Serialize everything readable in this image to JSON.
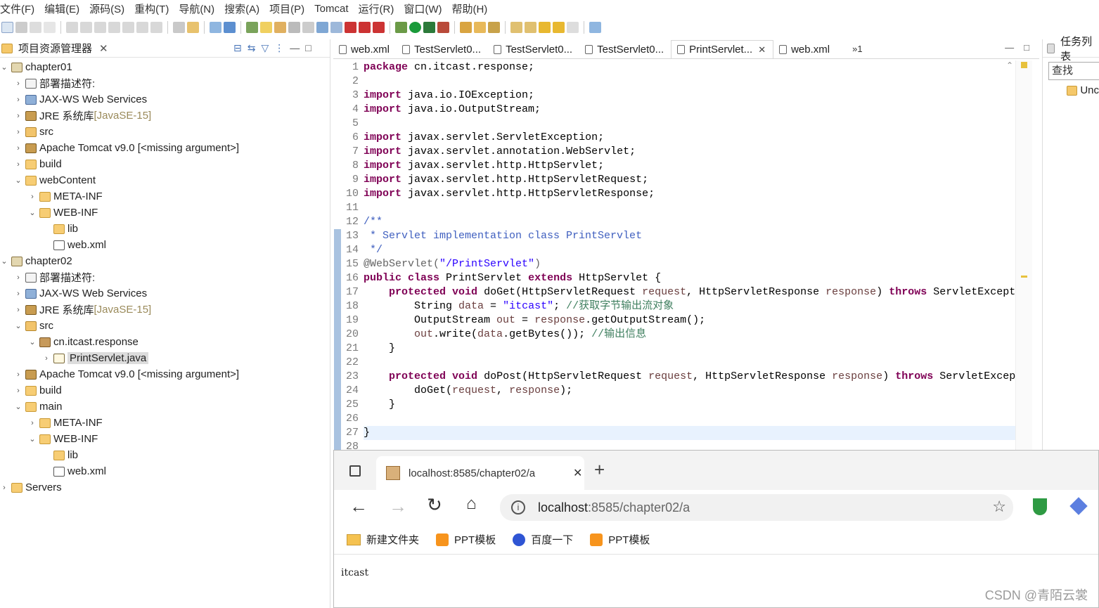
{
  "menu": [
    "文件(F)",
    "编辑(E)",
    "源码(S)",
    "重构(T)",
    "导航(N)",
    "搜索(A)",
    "项目(P)",
    "Tomcat",
    "运行(R)",
    "窗口(W)",
    "帮助(H)"
  ],
  "explorer": {
    "title": "项目资源管理器",
    "tree": [
      {
        "label": "chapter01",
        "suffix": "",
        "indent": 0,
        "arrow": "⌄",
        "icon": "project-icon"
      },
      {
        "label": "部署描述符:",
        "suffix": "",
        "indent": 1,
        "arrow": "›",
        "icon": "descriptor-icon"
      },
      {
        "label": "JAX-WS Web Services",
        "suffix": "",
        "indent": 1,
        "arrow": "›",
        "icon": "webservice-icon"
      },
      {
        "label": "JRE 系统库 ",
        "suffix": "[JavaSE-15]",
        "indent": 1,
        "arrow": "›",
        "icon": "library-icon"
      },
      {
        "label": "src",
        "suffix": "",
        "indent": 1,
        "arrow": "›",
        "icon": "source-folder-icon"
      },
      {
        "label": "Apache Tomcat v9.0 [<missing argument>]",
        "suffix": "",
        "indent": 1,
        "arrow": "›",
        "icon": "library-icon"
      },
      {
        "label": "build",
        "suffix": "",
        "indent": 1,
        "arrow": "›",
        "icon": "folder-icon"
      },
      {
        "label": "webContent",
        "suffix": "",
        "indent": 1,
        "arrow": "⌄",
        "icon": "folder-icon"
      },
      {
        "label": "META-INF",
        "suffix": "",
        "indent": 2,
        "arrow": "›",
        "icon": "folder-icon"
      },
      {
        "label": "WEB-INF",
        "suffix": "",
        "indent": 2,
        "arrow": "⌄",
        "icon": "folder-icon"
      },
      {
        "label": "lib",
        "suffix": "",
        "indent": 3,
        "arrow": "",
        "icon": "folder-icon"
      },
      {
        "label": "web.xml",
        "suffix": "",
        "indent": 3,
        "arrow": "",
        "icon": "xml-file-icon"
      },
      {
        "label": "chapter02",
        "suffix": "",
        "indent": 0,
        "arrow": "⌄",
        "icon": "project-icon"
      },
      {
        "label": "部署描述符:",
        "suffix": "",
        "indent": 1,
        "arrow": "›",
        "icon": "descriptor-icon"
      },
      {
        "label": "JAX-WS Web Services",
        "suffix": "",
        "indent": 1,
        "arrow": "›",
        "icon": "webservice-icon"
      },
      {
        "label": "JRE 系统库 ",
        "suffix": "[JavaSE-15]",
        "indent": 1,
        "arrow": "›",
        "icon": "library-icon"
      },
      {
        "label": "src",
        "suffix": "",
        "indent": 1,
        "arrow": "⌄",
        "icon": "source-folder-icon"
      },
      {
        "label": "cn.itcast.response",
        "suffix": "",
        "indent": 2,
        "arrow": "⌄",
        "icon": "package-icon"
      },
      {
        "label": "PrintServlet.java",
        "suffix": "",
        "indent": 3,
        "arrow": "›",
        "icon": "java-file-icon",
        "selected": true
      },
      {
        "label": "Apache Tomcat v9.0 [<missing argument>]",
        "suffix": "",
        "indent": 1,
        "arrow": "›",
        "icon": "library-icon"
      },
      {
        "label": "build",
        "suffix": "",
        "indent": 1,
        "arrow": "›",
        "icon": "folder-icon"
      },
      {
        "label": "main",
        "suffix": "",
        "indent": 1,
        "arrow": "⌄",
        "icon": "folder-icon"
      },
      {
        "label": "META-INF",
        "suffix": "",
        "indent": 2,
        "arrow": "›",
        "icon": "folder-icon"
      },
      {
        "label": "WEB-INF",
        "suffix": "",
        "indent": 2,
        "arrow": "⌄",
        "icon": "folder-icon"
      },
      {
        "label": "lib",
        "suffix": "",
        "indent": 3,
        "arrow": "",
        "icon": "folder-icon"
      },
      {
        "label": "web.xml",
        "suffix": "",
        "indent": 3,
        "arrow": "",
        "icon": "xml-file-icon"
      },
      {
        "label": "Servers",
        "suffix": "",
        "indent": 0,
        "arrow": "›",
        "icon": "folder-icon"
      }
    ]
  },
  "editor": {
    "tabs": [
      {
        "label": "web.xml",
        "active": false,
        "closable": false
      },
      {
        "label": "TestServlet0...",
        "active": false,
        "closable": false
      },
      {
        "label": "TestServlet0...",
        "active": false,
        "closable": false
      },
      {
        "label": "TestServlet0...",
        "active": false,
        "closable": false
      },
      {
        "label": "PrintServlet...",
        "active": true,
        "closable": true
      },
      {
        "label": "web.xml",
        "active": false,
        "closable": false
      }
    ],
    "overflow": "»1",
    "line_numbers": [
      "1",
      "2",
      "3",
      "4",
      "5",
      "6",
      "7",
      "8",
      "9",
      "10",
      "11",
      "12",
      "13",
      "14",
      "15",
      "16",
      "17",
      "18",
      "19",
      "20",
      "21",
      "22",
      "23",
      "24",
      "25",
      "26",
      "27",
      "28"
    ],
    "code": [
      [
        [
          "kw",
          "package"
        ],
        [
          "",
          "cn.itcast.response;"
        ]
      ],
      [],
      [
        [
          "kw",
          "import"
        ],
        [
          "",
          "java.io.IOException;"
        ]
      ],
      [
        [
          "kw",
          "import"
        ],
        [
          "",
          "java.io.OutputStream;"
        ]
      ],
      [],
      [
        [
          "kw",
          "import"
        ],
        [
          "",
          "javax.servlet.ServletException;"
        ]
      ],
      [
        [
          "kw",
          "import"
        ],
        [
          "",
          "javax.servlet.annotation.WebServlet;"
        ]
      ],
      [
        [
          "kw",
          "import"
        ],
        [
          "",
          "javax.servlet.http.HttpServlet;"
        ]
      ],
      [
        [
          "kw",
          "import"
        ],
        [
          "",
          "javax.servlet.http.HttpServletRequest;"
        ]
      ],
      [
        [
          "kw",
          "import"
        ],
        [
          "",
          "javax.servlet.http.HttpServletResponse;"
        ]
      ],
      [],
      [
        [
          "cm",
          "/**"
        ]
      ],
      [
        [
          "cm",
          " * Servlet implementation class PrintServlet"
        ]
      ],
      [
        [
          "cm",
          " */"
        ]
      ],
      [
        [
          "ann",
          "@WebServlet("
        ],
        [
          "str",
          "\"/PrintServlet\""
        ],
        [
          "ann",
          ")"
        ]
      ],
      [
        [
          "kw",
          "public class"
        ],
        [
          "",
          "PrintServlet "
        ],
        [
          "kw",
          "extends"
        ],
        [
          "",
          "HttpServlet {"
        ]
      ],
      [
        [
          "",
          "    "
        ],
        [
          "kw",
          "protected void"
        ],
        [
          "",
          "doGet(HttpServletRequest "
        ],
        [
          "var",
          "request"
        ],
        [
          "",
          ", HttpServletResponse "
        ],
        [
          "var",
          "response"
        ],
        [
          "",
          ") "
        ],
        [
          "kw",
          "throws"
        ],
        [
          "",
          "ServletExcept"
        ]
      ],
      [
        [
          "",
          "        String "
        ],
        [
          "var",
          "data"
        ],
        [
          "",
          " = "
        ],
        [
          "str",
          "\"itcast\""
        ],
        [
          "",
          "; "
        ],
        [
          "cmt",
          "//获取字节输出流对象"
        ]
      ],
      [
        [
          "",
          "        OutputStream "
        ],
        [
          "var",
          "out"
        ],
        [
          "",
          " = "
        ],
        [
          "var",
          "response"
        ],
        [
          "",
          ".getOutputStream();"
        ]
      ],
      [
        [
          "",
          "        "
        ],
        [
          "var",
          "out"
        ],
        [
          "",
          ".write("
        ],
        [
          "var",
          "data"
        ],
        [
          "",
          ".getBytes()); "
        ],
        [
          "cmt",
          "//输出信息"
        ]
      ],
      [
        [
          "",
          "    }"
        ]
      ],
      [],
      [
        [
          "",
          "    "
        ],
        [
          "kw",
          "protected void"
        ],
        [
          "",
          "doPost(HttpServletRequest "
        ],
        [
          "var",
          "request"
        ],
        [
          "",
          ", HttpServletResponse "
        ],
        [
          "var",
          "response"
        ],
        [
          "",
          ") "
        ],
        [
          "kw",
          "throws"
        ],
        [
          "",
          "ServletExcep"
        ]
      ],
      [
        [
          "",
          "        doGet("
        ],
        [
          "var",
          "request"
        ],
        [
          "",
          ", "
        ],
        [
          "var",
          "response"
        ],
        [
          "",
          ");"
        ]
      ],
      [
        [
          "",
          "    }"
        ]
      ],
      [],
      [
        [
          "",
          "}"
        ]
      ],
      []
    ]
  },
  "task_view": {
    "title": "任务列表",
    "search_placeholder": "查找",
    "item": "Unc"
  },
  "browser": {
    "tab_title": "localhost:8585/chapter02/a",
    "url_host": "localhost",
    "url_rest": ":8585/chapter02/a",
    "bookmarks": [
      {
        "label": "新建文件夹",
        "icon": "folder-icon"
      },
      {
        "label": "PPT模板",
        "icon": "ppt-icon"
      },
      {
        "label": "百度一下",
        "icon": "baidu-icon"
      },
      {
        "label": "PPT模板",
        "icon": "ppt-icon"
      }
    ],
    "page_text": "itcast"
  },
  "watermark": "CSDN @青陌云裳",
  "colors": {
    "keyword": "#7f0055",
    "comment": "#3f5fbf",
    "line_comment": "#3f7f5f",
    "string": "#2a00ff",
    "variable": "#6a3e3e",
    "accent": "#2d72c8"
  }
}
